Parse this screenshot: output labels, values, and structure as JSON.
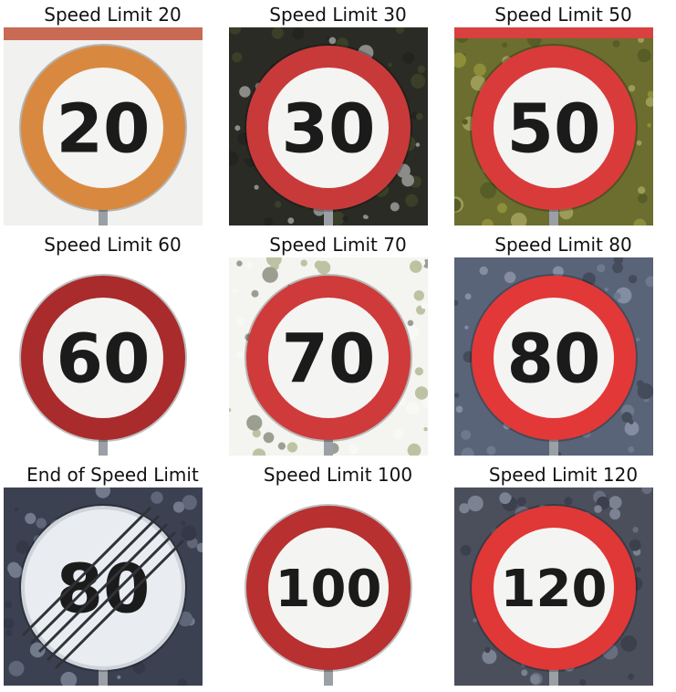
{
  "panels": [
    {
      "caption": "Speed Limit 20",
      "sign_text": "20",
      "background": "#f1f1ef",
      "ring": "#d9893f",
      "type": "limit"
    },
    {
      "caption": "Speed Limit 30",
      "sign_text": "30",
      "background": "#2b2b26",
      "ring": "#c83a3a",
      "type": "limit"
    },
    {
      "caption": "Speed Limit 50",
      "sign_text": "50",
      "background": "#6b6e2e",
      "ring": "#d93b3b",
      "type": "limit"
    },
    {
      "caption": "Speed Limit 60",
      "sign_text": "60",
      "background": "#ffffff",
      "ring": "#a92b2b",
      "type": "limit"
    },
    {
      "caption": "Speed Limit 70",
      "sign_text": "70",
      "background": "#f4f4f0",
      "ring": "#cf3a3a",
      "type": "limit"
    },
    {
      "caption": "Speed Limit 80",
      "sign_text": "80",
      "background": "#5a6478",
      "ring": "#e33838",
      "type": "limit"
    },
    {
      "caption": "End of Speed Limit",
      "sign_text": "80",
      "background": "#3c4152",
      "ring": "#cfd4da",
      "type": "end"
    },
    {
      "caption": "Speed Limit 100",
      "sign_text": "100",
      "background": "#ffffff",
      "ring": "#b83030",
      "type": "limit"
    },
    {
      "caption": "Speed Limit 120",
      "sign_text": "120",
      "background": "#4b4f5c",
      "ring": "#e03737",
      "type": "limit"
    }
  ]
}
